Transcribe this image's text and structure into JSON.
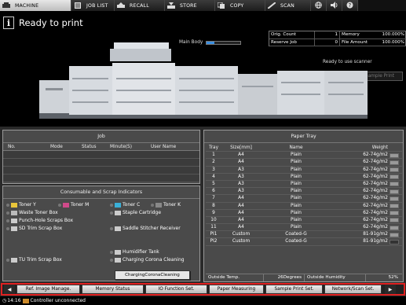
{
  "tabs": [
    {
      "label": "MACHINE",
      "icon": "machine-icon"
    },
    {
      "label": "JOB LIST",
      "icon": "job-list-icon"
    },
    {
      "label": "RECALL",
      "icon": "recall-icon"
    },
    {
      "label": "STORE",
      "icon": "store-icon"
    },
    {
      "label": "COPY",
      "icon": "copy-icon"
    },
    {
      "label": "SCAN",
      "icon": "scan-icon"
    }
  ],
  "header": {
    "title": "Ready to print",
    "main_body_label": "Main Body",
    "main_body_level": 0.22,
    "orig_count_label": "Orig. Count",
    "orig_count_value": "1",
    "reserve_job_label": "Reserve Job",
    "reserve_job_value": "0",
    "memory_label": "Memory",
    "memory_value": "100.000%",
    "file_amount_label": "File Amount",
    "file_amount_value": "100.000%",
    "scanner_status": "Ready to use scanner",
    "execute_sample_label": "Execute Sample Print"
  },
  "job": {
    "title": "Job",
    "columns": [
      "No.",
      "Mode",
      "Status",
      "Minute(S)",
      "User Name"
    ]
  },
  "consumables": {
    "title": "Consumable and Scrap Indicators",
    "items": [
      {
        "label": "Toner Y"
      },
      {
        "label": "Toner M"
      },
      {
        "label": "Toner C"
      },
      {
        "label": "Toner K"
      },
      {
        "label": "Waste Toner Box"
      },
      {
        "label": "Staple Cartridge"
      },
      {
        "label": "Punch-Hole Scraps Box"
      },
      {
        "label": "SD Trim Scrap Box"
      },
      {
        "label": "Saddle Stitcher Receiver"
      },
      {
        "label": "Humidifier Tank"
      },
      {
        "label": "TU Trim Scrap Box"
      },
      {
        "label": "Charging Corona Cleaning"
      }
    ],
    "charging_button": "ChargingCoronaCleaning"
  },
  "paper_tray": {
    "title": "Paper Tray",
    "columns": [
      "Tray",
      "Size[mm]",
      "Name",
      "Weight"
    ],
    "rows": [
      [
        "1",
        "A4",
        "Plain",
        "62-74g/m2"
      ],
      [
        "2",
        "A4",
        "Plain",
        "62-74g/m2"
      ],
      [
        "3",
        "A3",
        "Plain",
        "62-74g/m2"
      ],
      [
        "4",
        "A3",
        "Plain",
        "62-74g/m2"
      ],
      [
        "5",
        "A3",
        "Plain",
        "62-74g/m2"
      ],
      [
        "6",
        "A3",
        "Plain",
        "62-74g/m2"
      ],
      [
        "7",
        "A4",
        "Plain",
        "62-74g/m2"
      ],
      [
        "8",
        "A4",
        "Plain",
        "62-74g/m2"
      ],
      [
        "9",
        "A4",
        "Plain",
        "62-74g/m2"
      ],
      [
        "10",
        "A4",
        "Plain",
        "62-74g/m2"
      ],
      [
        "11",
        "A4",
        "Plain",
        "62-74g/m2"
      ],
      [
        "PI1",
        "Custom",
        "Coated-G",
        "81-91g/m2"
      ],
      [
        "PI2",
        "Custom",
        "Coated-G",
        "81-91g/m2"
      ]
    ],
    "outside_temp_label": "Outside Temp.",
    "outside_temp_value": "26Degrees",
    "outside_humidity_label": "Outside Humidity",
    "outside_humidity_value": "52%"
  },
  "function_bar": [
    "Ref. Image Manage.",
    "Memory Status",
    "IO Function Set.",
    "Paper Measuring",
    "Sample Print Set.",
    "Network/Scan Set."
  ],
  "status_line": {
    "time": "14:16",
    "text": "Controller unconnected"
  },
  "colors": {
    "accent_red": "#e02020",
    "progress_blue": "#3b8fe0"
  }
}
